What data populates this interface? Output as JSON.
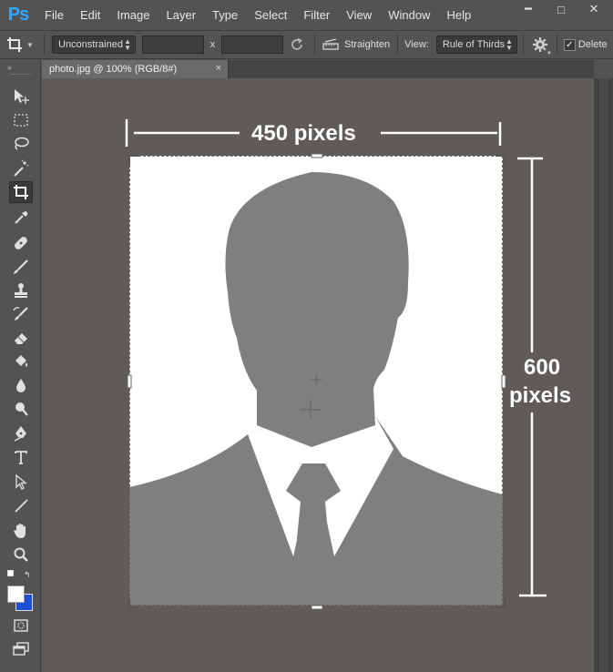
{
  "app": {
    "logo": "Ps"
  },
  "menu": [
    "File",
    "Edit",
    "Image",
    "Layer",
    "Type",
    "Select",
    "Filter",
    "View",
    "Window",
    "Help"
  ],
  "window_controls": {
    "minimize": "━",
    "maximize": "□",
    "close": "✕"
  },
  "options_bar": {
    "ratio_preset": "Unconstrained",
    "width_value": "",
    "x_separator": "x",
    "height_value": "",
    "straighten_label": "Straighten",
    "view_label": "View:",
    "view_value": "Rule of Thirds",
    "delete_label": "Delete",
    "delete_checked": true
  },
  "document_tab": {
    "title": "photo.jpg @ 100% (RGB/8#)",
    "close": "×"
  },
  "annotations": {
    "width_label": "450 pixels",
    "height_label_line1": "600",
    "height_label_line2": "pixels"
  },
  "colors": {
    "chrome": "#535353",
    "workspace": "#5f5b58",
    "silhouette": "#7f7e81",
    "foreground_swatch": "#ffffff",
    "background_swatch": "#1f4fd8",
    "ps_blue": "#31a8ff"
  },
  "tools": [
    "move-icon",
    "marquee-icon",
    "lasso-icon",
    "magic-wand-icon",
    "crop-icon",
    "eyedropper-icon",
    "healing-brush-icon",
    "brush-icon",
    "clone-stamp-icon",
    "history-brush-icon",
    "eraser-icon",
    "paint-bucket-icon",
    "blur-icon",
    "dodge-icon",
    "pen-icon",
    "type-icon",
    "path-selection-icon",
    "line-icon",
    "hand-icon",
    "zoom-icon",
    "quick-mask-icon",
    "screen-mode-icon"
  ]
}
